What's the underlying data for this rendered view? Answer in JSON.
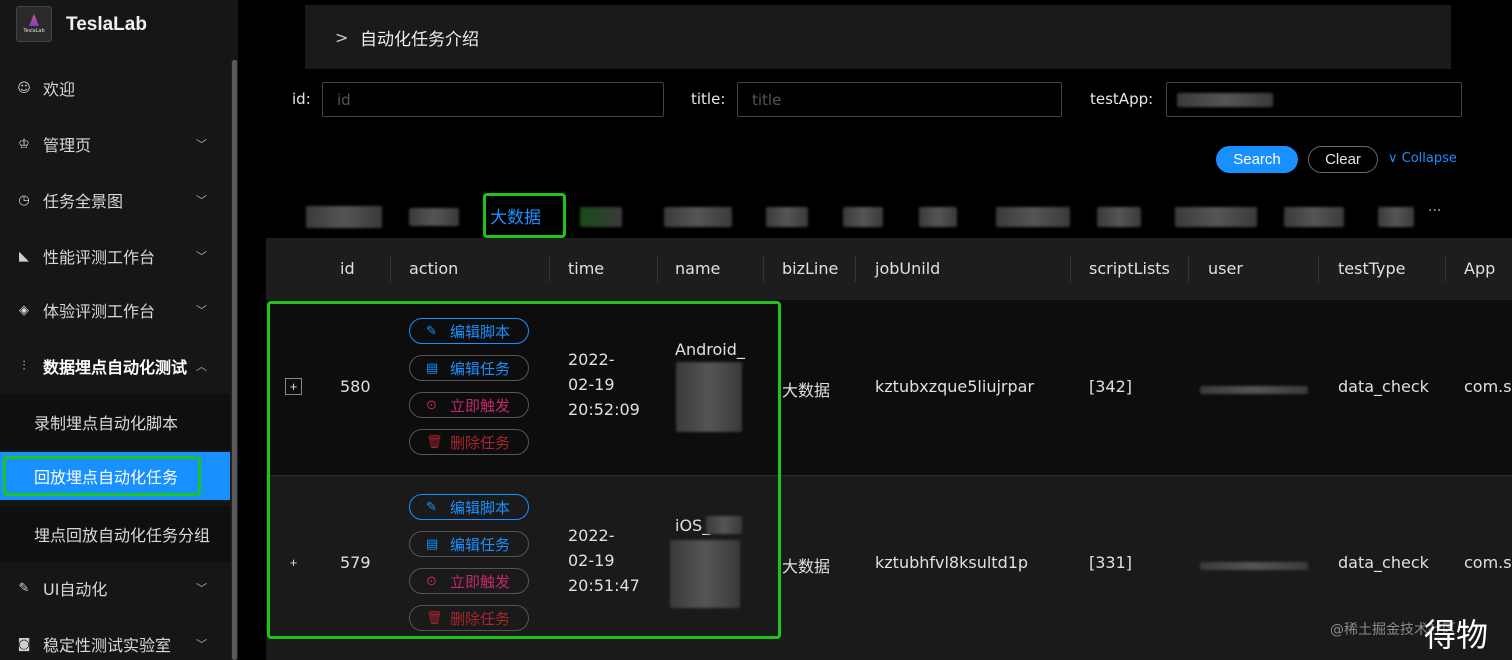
{
  "app": {
    "brand": "TeslaLab",
    "logo_text": "TeslaLab"
  },
  "sidebar": {
    "items": [
      {
        "label": "欢迎",
        "icon": "smile-icon"
      },
      {
        "label": "管理页",
        "icon": "crown-icon"
      },
      {
        "label": "任务全景图",
        "icon": "clock-icon"
      },
      {
        "label": "性能评测工作台",
        "icon": "area-chart-icon"
      },
      {
        "label": "体验评测工作台",
        "icon": "diamond-icon"
      },
      {
        "label": "数据埋点自动化测试",
        "icon": "sliders-icon"
      },
      {
        "label": "UI自动化",
        "icon": "edit-icon"
      },
      {
        "label": "稳定性测试实验室",
        "icon": "camera-icon"
      }
    ],
    "subitems": [
      {
        "label": "录制埋点自动化脚本"
      },
      {
        "label": "回放埋点自动化任务"
      },
      {
        "label": "埋点回放自动化任务分组"
      }
    ]
  },
  "panel": {
    "title": "自动化任务介绍"
  },
  "filters": {
    "id_label": "id",
    "id_placeholder": "id",
    "title_label": "title",
    "title_placeholder": "title",
    "testapp_label": "testApp"
  },
  "buttons": {
    "search": "Search",
    "clear": "Clear",
    "collapse": "Collapse"
  },
  "tabs": {
    "active": "大数据",
    "more": "···"
  },
  "table": {
    "columns": [
      "id",
      "action",
      "time",
      "name",
      "bizLine",
      "jobUnild",
      "scriptLists",
      "user",
      "testType",
      "App"
    ],
    "actions": [
      "编辑脚本",
      "编辑任务",
      "立即触发",
      "删除任务"
    ],
    "rows": [
      {
        "id": "580",
        "time_date": "2022-",
        "time_md": "02-19",
        "time_hms": "20:52:09",
        "name": "Android_",
        "bizLine": "大数据",
        "jobUnild": "kztubxzque5liujrpar",
        "scriptLists": "[342]",
        "testType": "data_check",
        "app": "com.sh"
      },
      {
        "id": "579",
        "time_date": "2022-",
        "time_md": "02-19",
        "time_hms": "20:51:47",
        "name": "iOS_",
        "bizLine": "大数据",
        "jobUnild": "kztubhfvl8ksultd1p",
        "scriptLists": "[331]",
        "testType": "data_check",
        "app": "com.sh"
      }
    ]
  },
  "watermark": {
    "text": "@稀土掘金技术社区",
    "logo": "得物"
  },
  "colors": {
    "accent": "#1890ff",
    "highlight": "#1ec41e",
    "trigger": "#c4286e",
    "delete": "#a8252f"
  }
}
